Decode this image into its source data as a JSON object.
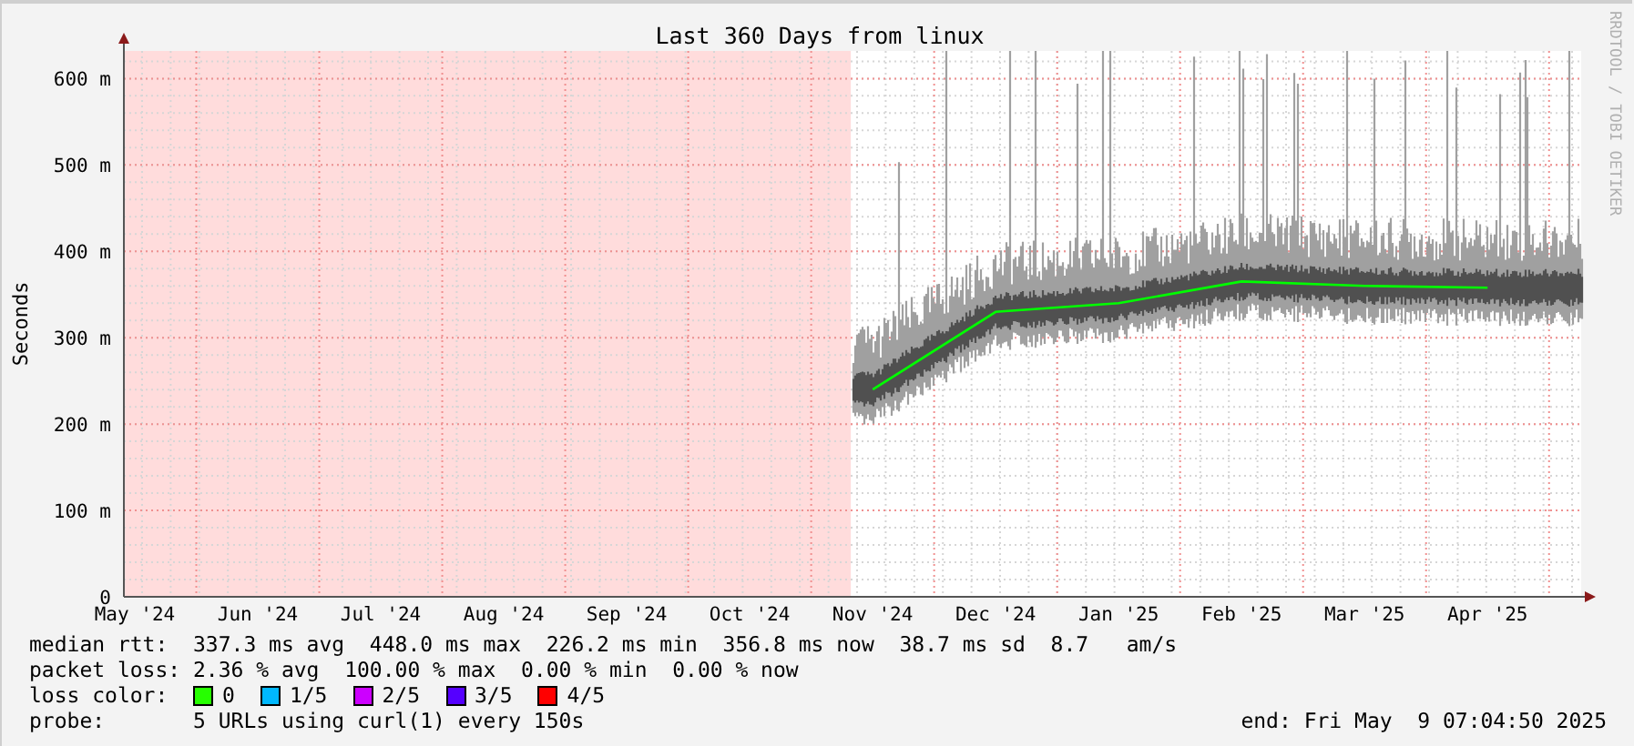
{
  "graph": {
    "title": "Last 360 Days from linux",
    "credit": "RRDTOOL / TOBI OETIKER",
    "chart_data": {
      "type": "line",
      "ylabel": "Seconds",
      "categories": [
        "May '24",
        "Jun '24",
        "Jul '24",
        "Aug '24",
        "Sep '24",
        "Oct '24",
        "Nov '24",
        "Dec '24",
        "Jan '25",
        "Feb '25",
        "Mar '25",
        "Apr '25"
      ],
      "series": [
        {
          "name": "median rtt:",
          "color": "#00ff00",
          "values": [
            null,
            null,
            null,
            null,
            null,
            null,
            240,
            330,
            340,
            365,
            360,
            358
          ]
        }
      ],
      "ylim": [
        0,
        632
      ],
      "grid": true,
      "yticks": [
        {
          "value": 0,
          "label": "0"
        },
        {
          "value": 100,
          "label": "100 m"
        },
        {
          "value": 200,
          "label": "200 m"
        },
        {
          "value": 300,
          "label": "300 m"
        },
        {
          "value": 400,
          "label": "400 m"
        },
        {
          "value": 500,
          "label": "500 m"
        },
        {
          "value": 600,
          "label": "600 m"
        }
      ]
    }
  },
  "legend": {
    "rtt": "337.3 ms avg  448.0 ms max  226.2 ms min  356.8 ms now  38.7 ms sd  8.7   am/s",
    "rows": [
      {
        "label": "packet loss:",
        "text": "2.36 % avg  100.00 % max  0.00 % min  0.00 % now"
      }
    ],
    "loss_label": "loss color:",
    "loss_colors": [
      {
        "label": "0",
        "color": "#26ff00"
      },
      {
        "label": "1/5",
        "color": "#00b8ff"
      },
      {
        "label": "2/5",
        "color": "#cc00ff"
      },
      {
        "label": "3/5",
        "color": "#5500ff"
      },
      {
        "label": "4/5",
        "color": "#ff0000"
      }
    ],
    "probe_label": "probe:",
    "probe": "5 URLs using curl(1) every 150s",
    "end": "end: Fri May  9 07:04:50 2025"
  }
}
